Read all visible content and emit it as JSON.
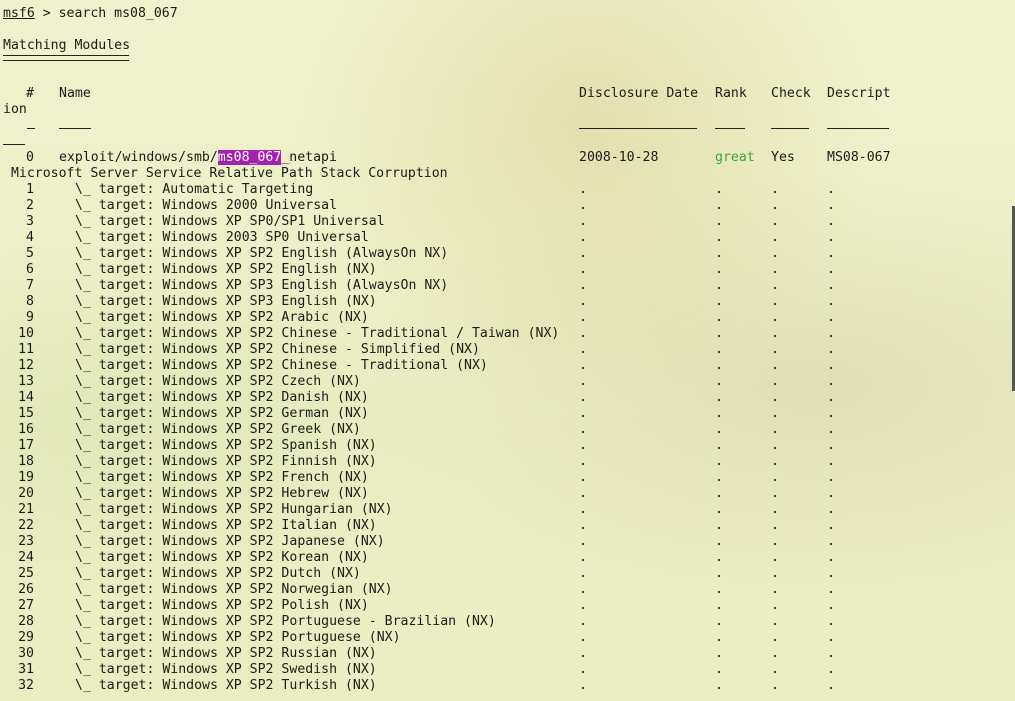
{
  "prompt": {
    "name": "msf6",
    "separator": " > ",
    "command": "search ms08_067"
  },
  "heading": "Matching Modules",
  "headers": {
    "num": "#",
    "name": "Name",
    "date": "Disclosure Date",
    "rank": "Rank",
    "check": "Check",
    "desc": "Descript",
    "desc_wrap": "ion"
  },
  "module": {
    "num": "0",
    "name_prefix": "exploit/windows/smb/",
    "name_match": "ms08_067",
    "name_suffix": "_netapi",
    "date": "2008-10-28",
    "rank": "great",
    "check": "Yes",
    "desc": "MS08-067",
    "desc_wrap": " Microsoft Server Service Relative Path Stack Corruption"
  },
  "target_prefix": "\\_ target: ",
  "dot": ".",
  "targets": [
    {
      "num": "1",
      "label": "Automatic Targeting"
    },
    {
      "num": "2",
      "label": "Windows 2000 Universal"
    },
    {
      "num": "3",
      "label": "Windows XP SP0/SP1 Universal"
    },
    {
      "num": "4",
      "label": "Windows 2003 SP0 Universal"
    },
    {
      "num": "5",
      "label": "Windows XP SP2 English (AlwaysOn NX)"
    },
    {
      "num": "6",
      "label": "Windows XP SP2 English (NX)"
    },
    {
      "num": "7",
      "label": "Windows XP SP3 English (AlwaysOn NX)"
    },
    {
      "num": "8",
      "label": "Windows XP SP3 English (NX)"
    },
    {
      "num": "9",
      "label": "Windows XP SP2 Arabic (NX)"
    },
    {
      "num": "10",
      "label": "Windows XP SP2 Chinese - Traditional / Taiwan (NX)"
    },
    {
      "num": "11",
      "label": "Windows XP SP2 Chinese - Simplified (NX)"
    },
    {
      "num": "12",
      "label": "Windows XP SP2 Chinese - Traditional (NX)"
    },
    {
      "num": "13",
      "label": "Windows XP SP2 Czech (NX)"
    },
    {
      "num": "14",
      "label": "Windows XP SP2 Danish (NX)"
    },
    {
      "num": "15",
      "label": "Windows XP SP2 German (NX)"
    },
    {
      "num": "16",
      "label": "Windows XP SP2 Greek (NX)"
    },
    {
      "num": "17",
      "label": "Windows XP SP2 Spanish (NX)"
    },
    {
      "num": "18",
      "label": "Windows XP SP2 Finnish (NX)"
    },
    {
      "num": "19",
      "label": "Windows XP SP2 French (NX)"
    },
    {
      "num": "20",
      "label": "Windows XP SP2 Hebrew (NX)"
    },
    {
      "num": "21",
      "label": "Windows XP SP2 Hungarian (NX)"
    },
    {
      "num": "22",
      "label": "Windows XP SP2 Italian (NX)"
    },
    {
      "num": "23",
      "label": "Windows XP SP2 Japanese (NX)"
    },
    {
      "num": "24",
      "label": "Windows XP SP2 Korean (NX)"
    },
    {
      "num": "25",
      "label": "Windows XP SP2 Dutch (NX)"
    },
    {
      "num": "26",
      "label": "Windows XP SP2 Norwegian (NX)"
    },
    {
      "num": "27",
      "label": "Windows XP SP2 Polish (NX)"
    },
    {
      "num": "28",
      "label": "Windows XP SP2 Portuguese - Brazilian (NX)"
    },
    {
      "num": "29",
      "label": "Windows XP SP2 Portuguese (NX)"
    },
    {
      "num": "30",
      "label": "Windows XP SP2 Russian (NX)"
    },
    {
      "num": "31",
      "label": "Windows XP SP2 Swedish (NX)"
    },
    {
      "num": "32",
      "label": "Windows XP SP2 Turkish (NX)"
    }
  ],
  "colors": {
    "highlight": "#a620b0",
    "rank_great": "#3da83d",
    "background": "#eef0c6"
  }
}
